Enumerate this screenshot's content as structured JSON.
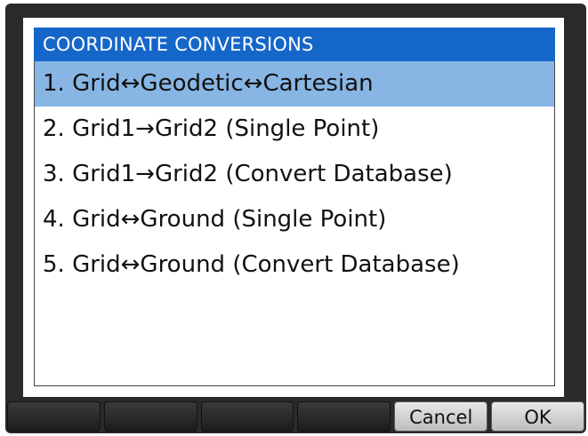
{
  "dialog": {
    "title": "COORDINATE CONVERSIONS",
    "items": [
      {
        "label": "1. Grid↔Geodetic↔Cartesian",
        "selected": true
      },
      {
        "label": "2. Grid1→Grid2 (Single Point)",
        "selected": false
      },
      {
        "label": "3. Grid1→Grid2 (Convert Database)",
        "selected": false
      },
      {
        "label": "4. Grid↔Ground (Single Point)",
        "selected": false
      },
      {
        "label": "5. Grid↔Ground (Convert Database)",
        "selected": false
      }
    ]
  },
  "softkeys": {
    "cancel_label": "Cancel",
    "ok_label": "OK"
  },
  "colors": {
    "title_bar": "#1566c9",
    "selected_row": "#87b6e4"
  }
}
